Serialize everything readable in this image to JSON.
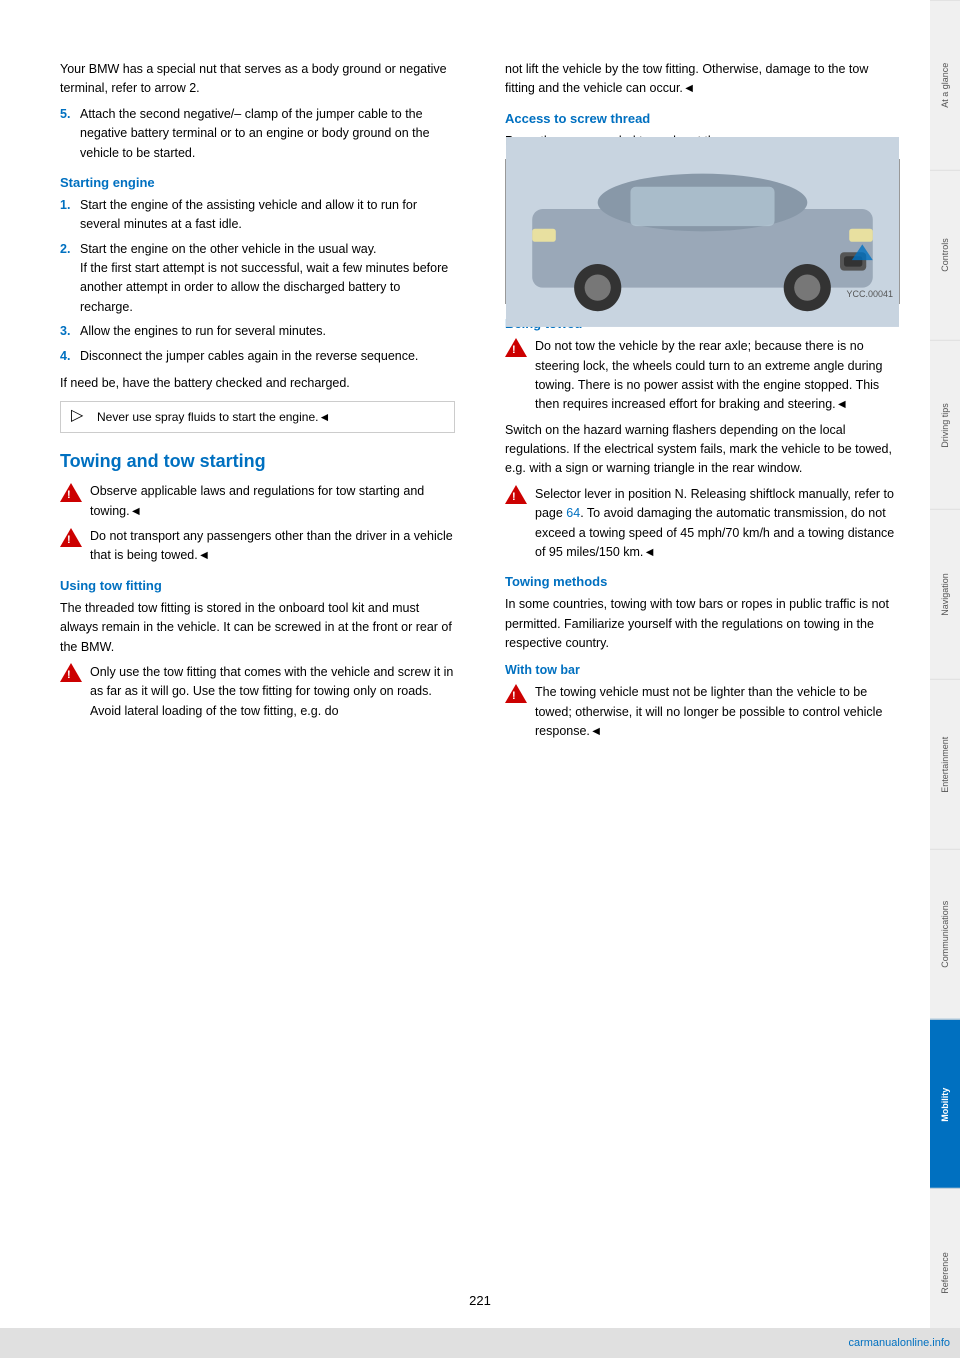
{
  "page": {
    "number": "221",
    "watermark": "carmanualonline.info"
  },
  "sidebar": {
    "tabs": [
      {
        "label": "At a glance",
        "active": false
      },
      {
        "label": "Controls",
        "active": false
      },
      {
        "label": "Driving tips",
        "active": false
      },
      {
        "label": "Navigation",
        "active": false
      },
      {
        "label": "Entertainment",
        "active": false
      },
      {
        "label": "Communications",
        "active": false
      },
      {
        "label": "Mobility",
        "active": true
      },
      {
        "label": "Reference",
        "active": false
      }
    ]
  },
  "left_col": {
    "intro_text": "Your BMW has a special nut that serves as a body ground or negative terminal, refer to arrow 2.",
    "step5": "Attach the second negative/– clamp of the jumper cable to the negative battery terminal or to an engine or body ground on the vehicle to be started.",
    "starting_engine": {
      "heading": "Starting engine",
      "steps": [
        "Start the engine of the assisting vehicle and allow it to run for several minutes at a fast idle.",
        "Start the engine on the other vehicle in the usual way.\nIf the first start attempt is not successful, wait a few minutes before another attempt in order to allow the discharged battery to recharge.",
        "Allow the engines to run for several minutes.",
        "Disconnect the jumper cables again in the reverse sequence."
      ]
    },
    "recharge_text": "If need be, have the battery checked and recharged.",
    "spray_note": "Never use spray fluids to start the engine.◄",
    "towing_section": {
      "heading": "Towing and tow starting",
      "warning1": "Observe applicable laws and regulations for tow starting and towing.◄",
      "warning2": "Do not transport any passengers other than the driver in a vehicle that is being towed.◄",
      "using_tow_fitting": {
        "heading": "Using tow fitting",
        "text1": "The threaded tow fitting is stored in the onboard tool kit and must always remain in the vehicle. It can be screwed in at the front or rear of the BMW.",
        "warning": "Only use the tow fitting that comes with the vehicle and screw it in as far as it will go. Use the tow fitting for towing only on roads. Avoid lateral loading of the tow fitting, e.g. do"
      }
    }
  },
  "right_col": {
    "intro_text": "not lift the vehicle by the tow fitting. Otherwise, damage to the tow fitting and the vehicle can occur.◄",
    "access_screw_thread": {
      "heading": "Access to screw thread",
      "text": "Press the arrow symbol to push out the cover."
    },
    "being_towed": {
      "heading": "Being towed",
      "warning1": "Do not tow the vehicle by the rear axle; because there is no steering lock, the wheels could turn to an extreme angle during towing. There is no power assist with the engine stopped. This then requires increased effort for braking and steering.◄",
      "text1": "Switch on the hazard warning flashers depending on the local regulations. If the electrical system fails, mark the vehicle to be towed, e.g. with a sign or warning triangle in the rear window.",
      "warning2": "Selector lever in position N. Releasing shiftlock manually, refer to page 64. To avoid damaging the automatic transmission, do not exceed a towing speed of 45 mph/70 km/h and a towing distance of 95 miles/150 km.◄"
    },
    "towing_methods": {
      "heading": "Towing methods",
      "text1": "In some countries, towing with tow bars or ropes in public traffic is not permitted. Familiarize yourself with the regulations on towing in the respective country.",
      "with_tow_bar": {
        "heading": "With tow bar",
        "warning": "The towing vehicle must not be lighter than the vehicle to be towed; otherwise, it will no longer be possible to control vehicle response.◄"
      }
    }
  }
}
